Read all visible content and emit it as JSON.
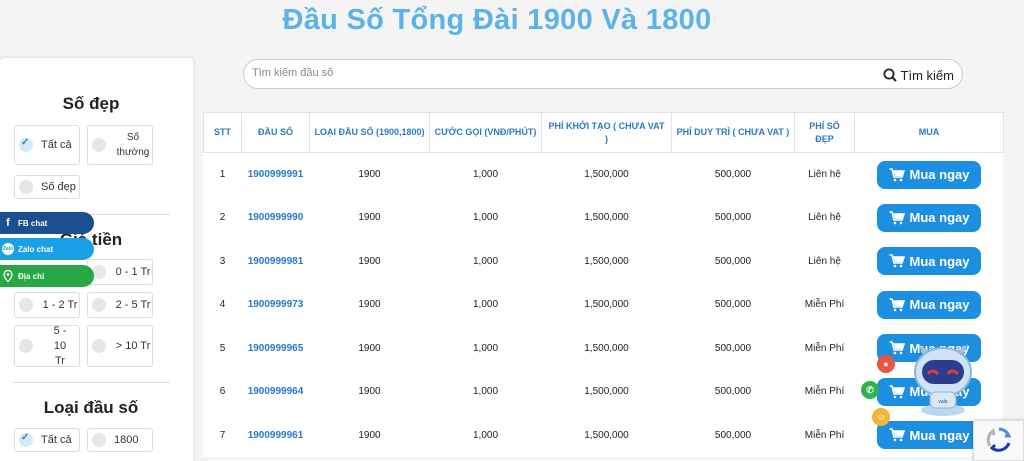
{
  "page": {
    "title": "Đầu Số Tổng Đài 1900 Và 1800"
  },
  "sidebar": {
    "so_dep": {
      "heading": "Số đẹp",
      "options": [
        "Tất cả",
        "Số thường",
        "Số đẹp"
      ]
    },
    "gia_tien": {
      "heading": "Giá tiền",
      "options": [
        "0 - 1 Tr",
        "1 - 2 Tr",
        "2 - 5 Tr",
        "5 - 10 Tr",
        "> 10 Tr"
      ]
    },
    "loai_dau_so": {
      "heading": "Loại đầu số",
      "options": [
        "Tất cả",
        "1800"
      ]
    }
  },
  "float_buttons": {
    "fb": "FB chat",
    "zalo": "Zalo chat",
    "address": "Địa chỉ"
  },
  "search": {
    "placeholder": "Tìm kiếm đầu số",
    "button_label": "Tìm kiếm"
  },
  "table": {
    "headers": [
      "STT",
      "ĐẦU SỐ",
      "LOẠI ĐẦU SỐ (1900,1800)",
      "CƯỚC GỌI (VNĐ/PHÚT)",
      "PHÍ KHỞI TẠO ( CHƯA VAT )",
      "PHÍ DUY TRÌ ( CHƯA VAT )",
      "PHÍ SỐ ĐẸP",
      "MUA"
    ],
    "rows": [
      {
        "stt": "1",
        "dau_so": "1900999991",
        "loai": "1900",
        "cuoc_goi": "1,000",
        "phi_khoi_tao": "1,500,000",
        "phi_duy_tri": "500,000",
        "phi_so_dep": "Liên hệ"
      },
      {
        "stt": "2",
        "dau_so": "1900999990",
        "loai": "1900",
        "cuoc_goi": "1,000",
        "phi_khoi_tao": "1,500,000",
        "phi_duy_tri": "500,000",
        "phi_so_dep": "Liên hệ"
      },
      {
        "stt": "3",
        "dau_so": "1900999981",
        "loai": "1900",
        "cuoc_goi": "1,000",
        "phi_khoi_tao": "1,500,000",
        "phi_duy_tri": "500,000",
        "phi_so_dep": "Liên hệ"
      },
      {
        "stt": "4",
        "dau_so": "1900999973",
        "loai": "1900",
        "cuoc_goi": "1,000",
        "phi_khoi_tao": "1,500,000",
        "phi_duy_tri": "500,000",
        "phi_so_dep": "Miễn Phí"
      },
      {
        "stt": "5",
        "dau_so": "1900999965",
        "loai": "1900",
        "cuoc_goi": "1,000",
        "phi_khoi_tao": "1,500,000",
        "phi_duy_tri": "500,000",
        "phi_so_dep": "Miễn Phí"
      },
      {
        "stt": "6",
        "dau_so": "1900999964",
        "loai": "1900",
        "cuoc_goi": "1,000",
        "phi_khoi_tao": "1,500,000",
        "phi_duy_tri": "500,000",
        "phi_so_dep": "Miễn Phí"
      },
      {
        "stt": "7",
        "dau_so": "1900999961",
        "loai": "1900",
        "cuoc_goi": "1,000",
        "phi_khoi_tao": "1,500,000",
        "phi_duy_tri": "500,000",
        "phi_so_dep": "Miễn Phí"
      }
    ],
    "buy_label": "Mua ngay"
  },
  "colors": {
    "accent": "#1d8fe1",
    "title": "#5bb3ea",
    "fb": "#1b4f8f",
    "zalo": "#1aa1e5",
    "address": "#27a745"
  },
  "icons": {
    "search": "search-icon",
    "cart": "cart-icon",
    "bot": "chatbot-icon"
  }
}
